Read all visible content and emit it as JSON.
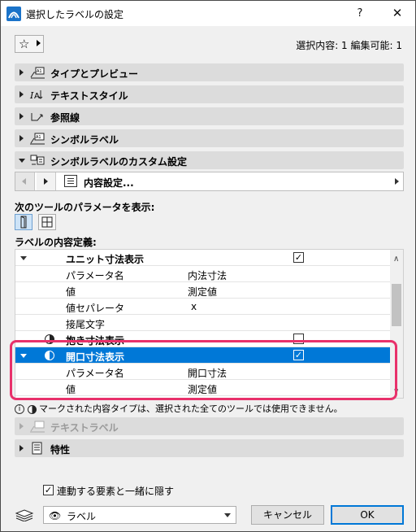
{
  "window": {
    "title": "選択したラベルの設定",
    "help": "?",
    "close": "✕"
  },
  "favorites": {
    "star": "☆"
  },
  "selection_info": "選択内容: 1 編集可能: 1",
  "sections": [
    {
      "label": "タイプとプレビュー",
      "icon": "type-preview-icon"
    },
    {
      "label": "テキストスタイル",
      "icon": "text-style-icon"
    },
    {
      "label": "参照線",
      "icon": "leader-line-icon"
    },
    {
      "label": "シンボルラベル",
      "icon": "symbol-label-icon"
    },
    {
      "label": "シンボルラベルのカスタム設定",
      "icon": "custom-symbol-label-icon"
    }
  ],
  "content_nav": {
    "label": "内容設定..."
  },
  "tools_heading": "次のツールのパラメータを表示:",
  "content_heading": "ラベルの内容定義:",
  "table_rows": [
    {
      "name": "ユニット寸法表示",
      "value": "",
      "type": "group",
      "checked": true
    },
    {
      "name": "パラメータ名",
      "value": "内法寸法",
      "type": "param"
    },
    {
      "name": "値",
      "value": "測定値",
      "type": "param"
    },
    {
      "name": "値セパレータ",
      "value": "x",
      "type": "param"
    },
    {
      "name": "接尾文字",
      "value": "",
      "type": "param"
    },
    {
      "name": "抱き寸法表示",
      "value": "",
      "type": "half",
      "checked": false
    },
    {
      "name": "開口寸法表示",
      "value": "",
      "type": "selected",
      "checked": true
    },
    {
      "name": "パラメータ名",
      "value": "開口寸法",
      "type": "param"
    },
    {
      "name": "値",
      "value": "測定値",
      "type": "param"
    }
  ],
  "note": "マークされた内容タイプは、選択された全てのツールでは使用できません。",
  "lower_sections": [
    {
      "label": "テキストラベル",
      "disabled": true
    },
    {
      "label": "特性",
      "disabled": false
    }
  ],
  "hide_checkbox": {
    "label": "連動する要素と一緒に隠す",
    "checked": true
  },
  "layer_dropdown": {
    "value": "ラベル"
  },
  "buttons": {
    "cancel": "キャンセル",
    "ok": "OK"
  }
}
